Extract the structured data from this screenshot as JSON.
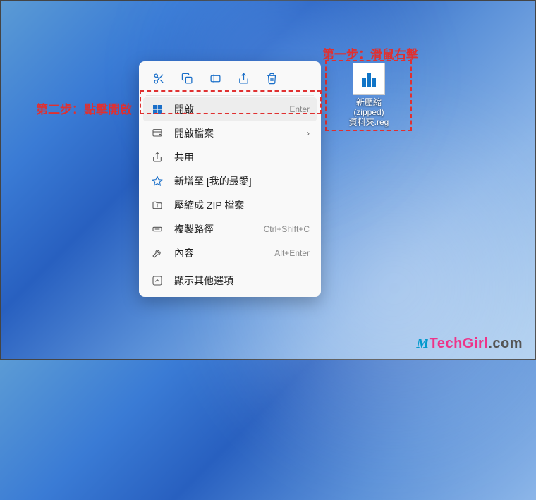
{
  "annotations": {
    "step1": "第一步：滑鼠右擊",
    "step2": "第二步：點擊開啟"
  },
  "file": {
    "name_line1": "新壓縮",
    "name_line2": "(zipped)",
    "name_line3": "資料夾.reg"
  },
  "contextmenu": {
    "open": {
      "label": "開啟",
      "shortcut": "Enter"
    },
    "openwith": {
      "label": "開啟檔案"
    },
    "share": {
      "label": "共用"
    },
    "favorites": {
      "label": "新增至 [我的最愛]"
    },
    "zip": {
      "label": "壓縮成 ZIP 檔案"
    },
    "copypath": {
      "label": "複製路徑",
      "shortcut": "Ctrl+Shift+C"
    },
    "properties": {
      "label": "內容",
      "shortcut": "Alt+Enter"
    },
    "more": {
      "label": "顯示其他選項"
    }
  },
  "watermark": {
    "part1": "M",
    "part2": "TechGirl",
    "part3": ".com"
  }
}
